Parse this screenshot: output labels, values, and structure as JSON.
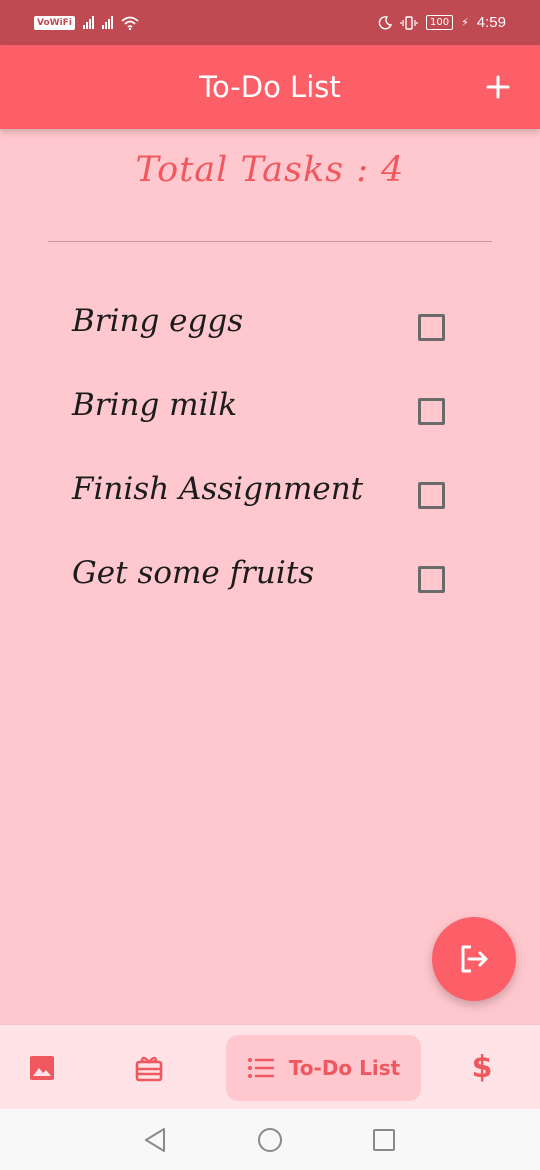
{
  "status_bar": {
    "vowifi": "VoWiFi",
    "battery": "100",
    "time": "4:59"
  },
  "app_bar": {
    "title": "To-Do List",
    "add_icon": "plus-icon"
  },
  "summary": {
    "total_text": "Total Tasks : 4"
  },
  "tasks": [
    {
      "label": "Bring eggs",
      "checked": false
    },
    {
      "label": "Bring milk",
      "checked": false
    },
    {
      "label": "Finish Assignment",
      "checked": false
    },
    {
      "label": "Get some fruits",
      "checked": false
    }
  ],
  "fab": {
    "icon": "logout-icon"
  },
  "bottom_nav": {
    "items": [
      {
        "icon": "image-icon"
      },
      {
        "icon": "gift-icon"
      },
      {
        "icon": "list-icon",
        "label": "To-Do List",
        "active": true
      },
      {
        "icon": "dollar-icon",
        "glyph": "$"
      }
    ]
  },
  "system_nav": {
    "buttons": [
      "back-icon",
      "home-icon",
      "recents-icon"
    ]
  },
  "colors": {
    "primary": "#fd5f68",
    "background": "#ffc8ce",
    "status_bar": "#c04a52",
    "accent_text": "#f0585f"
  }
}
